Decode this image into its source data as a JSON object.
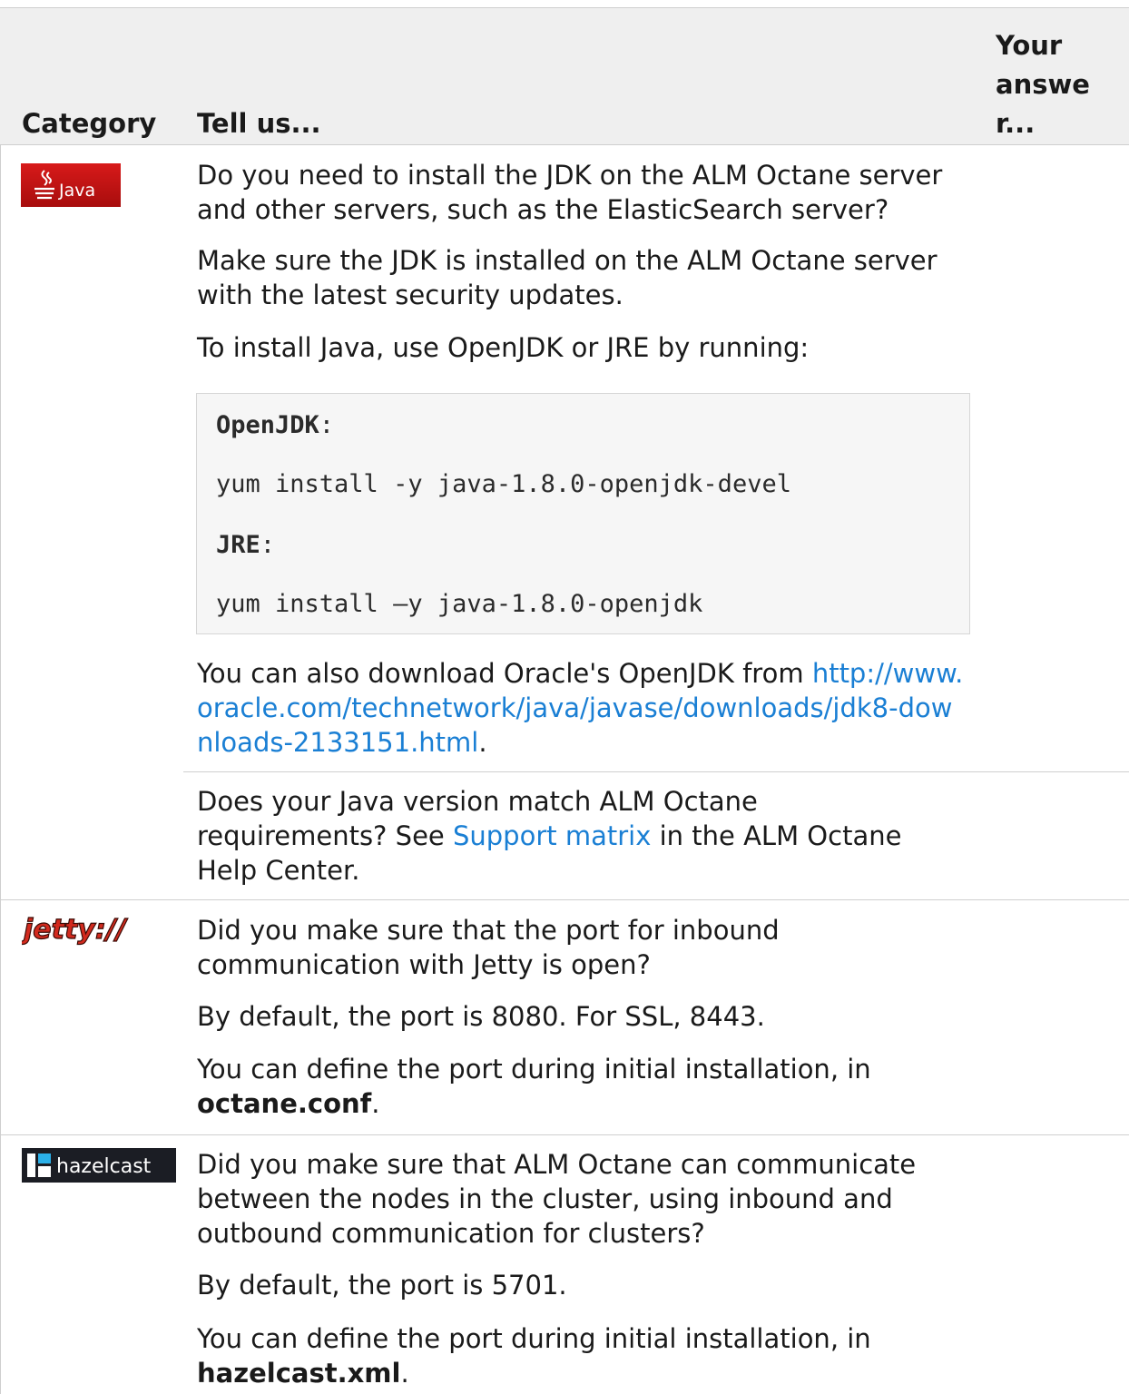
{
  "header": {
    "col_category": "Category",
    "col_tell_us": "Tell us...",
    "col_answer_lines": [
      "Your",
      "answe",
      "r..."
    ]
  },
  "java": {
    "icon": "java-logo-icon",
    "logo_text": "Java",
    "q1": "Do you need to install the JDK on the ALM Octane server and other servers, such as the ElasticSearch server?",
    "p2": "Make sure the JDK is installed on the ALM Octane server with the latest security updates.",
    "p3": "To install Java, use OpenJDK or JRE by running:",
    "code": {
      "label1": "OpenJDK",
      "colon": ":",
      "cmd1": "yum install -y java-1.8.0-openjdk-devel",
      "label2": "JRE",
      "cmd2": "yum install –y java-1.8.0-openjdk"
    },
    "p4_prefix": "You can also download Oracle's OpenJDK from",
    "p4_link": "http://www.oracle.com/technetwork/java/javase/downloads/jdk8-downloads-2133151.html",
    "p4_suffix": ".",
    "q2_prefix": "Does your Java version match ALM Octane requirements? See",
    "q2_link": "Support matrix",
    "q2_suffix": "in the ALM Octane Help Center."
  },
  "jetty": {
    "icon": "jetty-logo-icon",
    "logo_text": "jetty://",
    "q1": "Did you make sure that the port for inbound communication with Jetty is open?",
    "p2": "By default, the port is 8080. For SSL, 8443.",
    "p3_prefix": "You can define the port during initial installation, in",
    "p3_bold": "octane.conf",
    "p3_suffix": "."
  },
  "hazelcast": {
    "icon": "hazelcast-logo-icon",
    "logo_text": "hazelcast",
    "q1": "Did you make sure that  ALM Octane can communicate between the nodes in the cluster, using inbound and outbound communication for clusters?",
    "p2": "By default, the port is 5701.",
    "p3_prefix": "You can define the port during initial installation, in",
    "p3_bold": "hazelcast.xml",
    "p3_suffix": "."
  },
  "colors": {
    "link": "#1a7fd4",
    "header_bg": "#efefef",
    "code_bg": "#f6f6f6"
  }
}
